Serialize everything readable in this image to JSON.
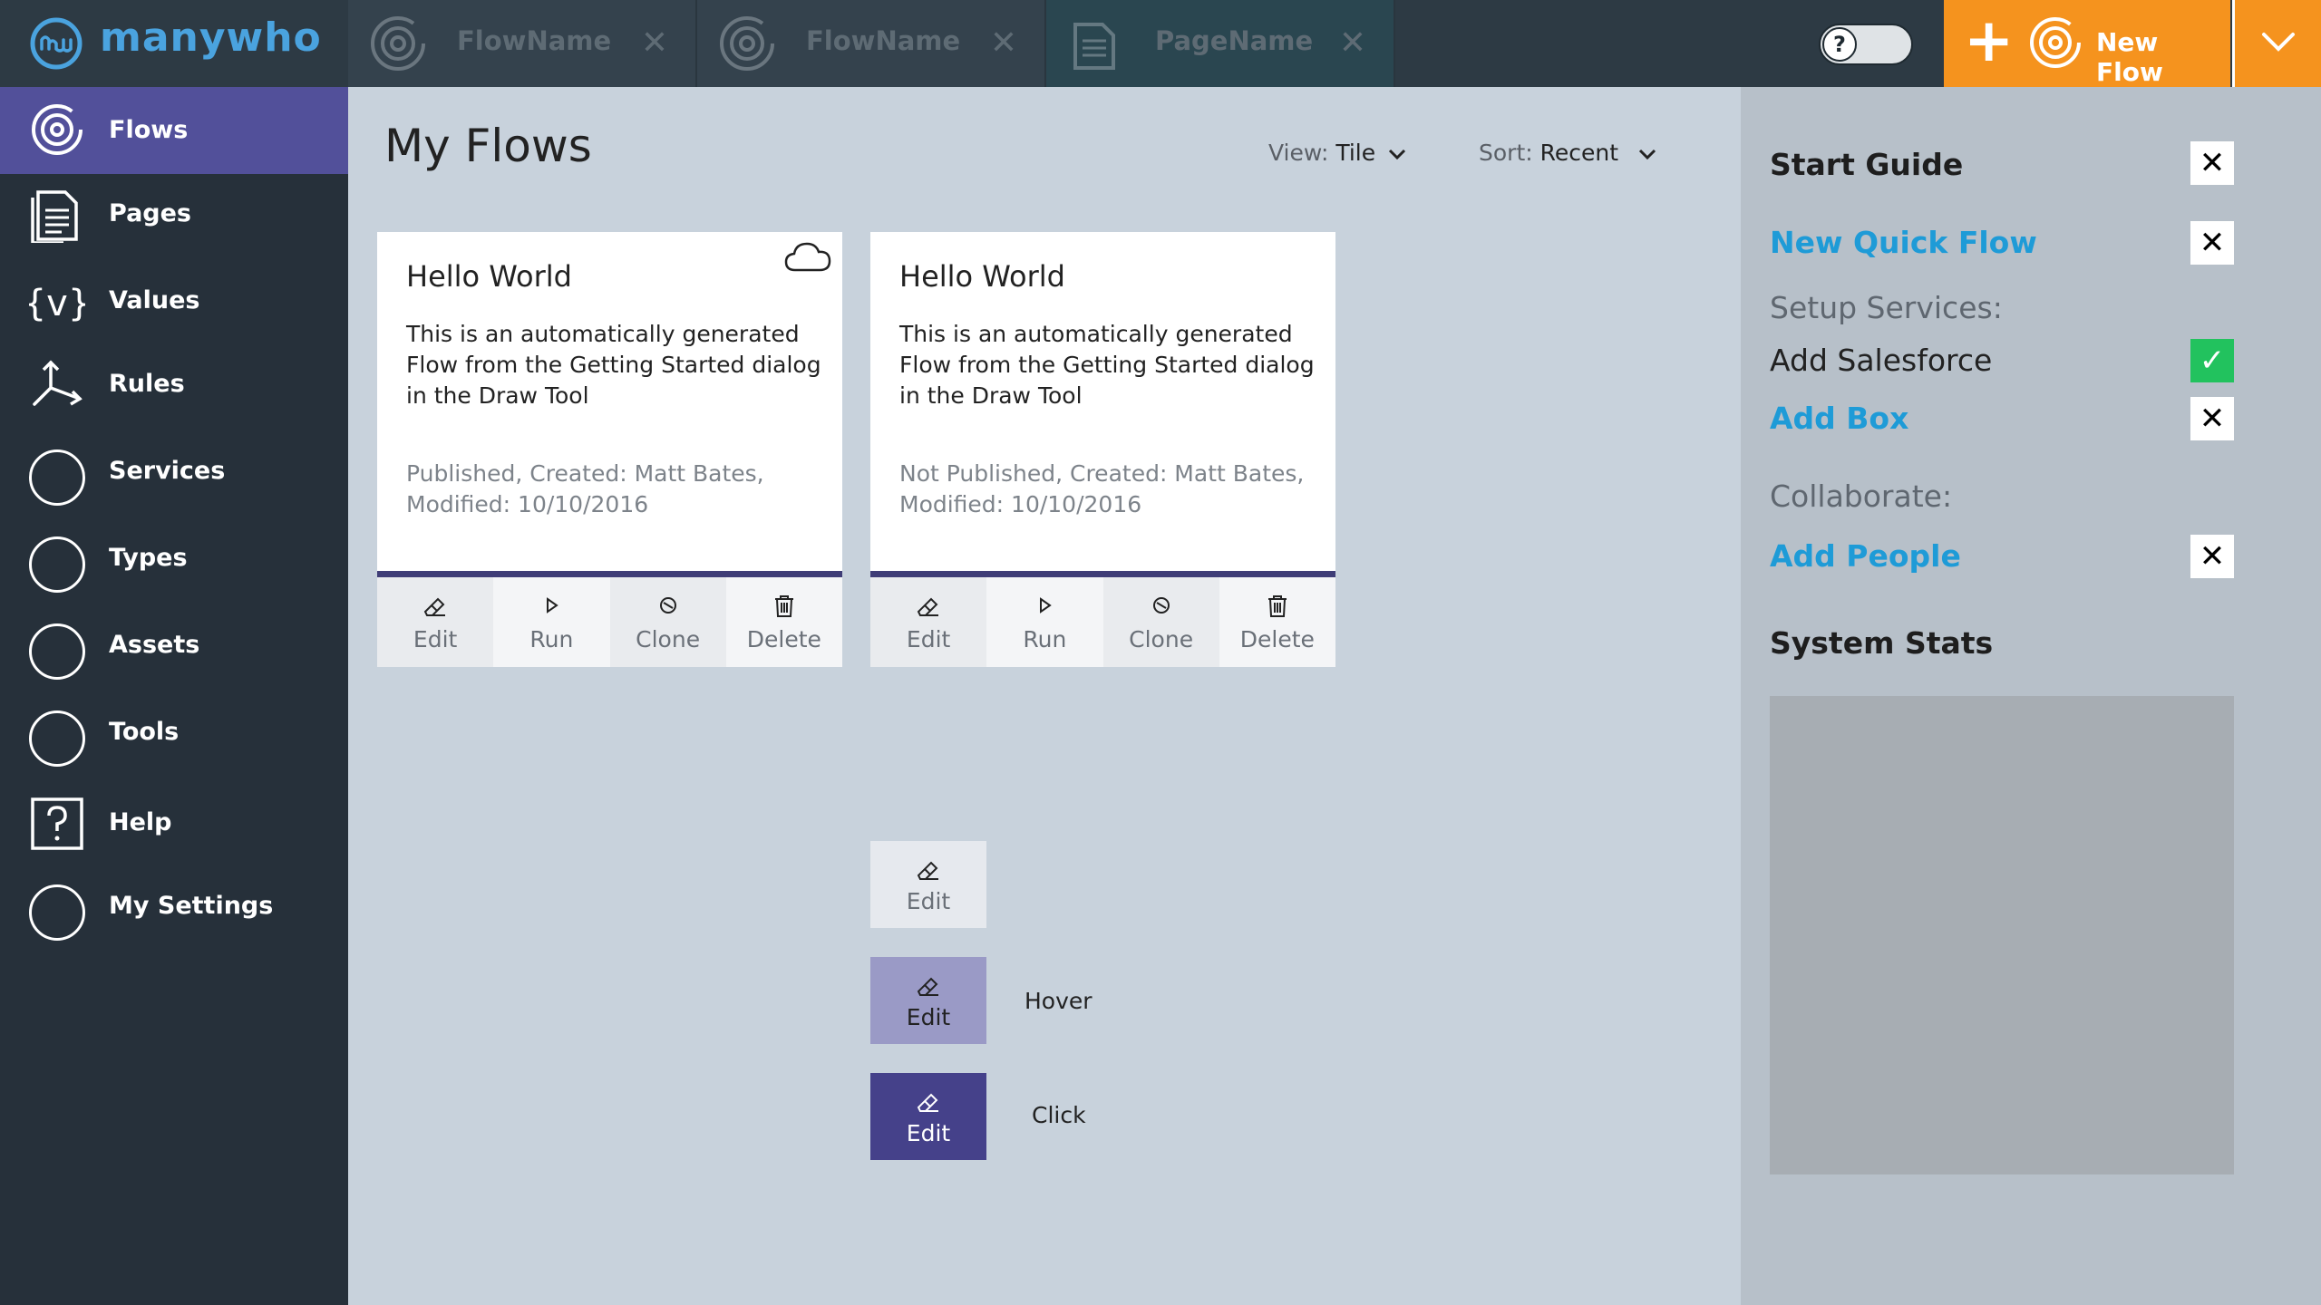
{
  "brand": {
    "logo_text": "manywho"
  },
  "tabs": [
    {
      "label": "FlowName",
      "icon": "flow-icon",
      "close": "✕"
    },
    {
      "label": "FlowName",
      "icon": "flow-icon",
      "close": "✕"
    },
    {
      "label": "PageName",
      "icon": "page-icon",
      "close": "✕"
    }
  ],
  "toggle": {
    "glyph": "?"
  },
  "new_flow": {
    "plus": "+",
    "label": "New Flow"
  },
  "sidebar": {
    "items": [
      {
        "label": "Flows",
        "icon": "flows-icon"
      },
      {
        "label": "Pages",
        "icon": "pages-icon"
      },
      {
        "label": "Values",
        "icon": "values-icon"
      },
      {
        "label": "Rules",
        "icon": "rules-icon"
      },
      {
        "label": "Services",
        "icon": "circle-icon"
      },
      {
        "label": "Types",
        "icon": "circle-icon"
      },
      {
        "label": "Assets",
        "icon": "circle-icon"
      },
      {
        "label": "Tools",
        "icon": "circle-icon"
      },
      {
        "label": "Help",
        "icon": "help-icon"
      },
      {
        "label": "My Settings",
        "icon": "circle-icon"
      }
    ]
  },
  "main": {
    "title": "My Flows",
    "view": {
      "label": "View:",
      "value": "Tile"
    },
    "sort": {
      "label": "Sort:",
      "value": "Recent"
    },
    "cards": [
      {
        "title": "Hello World",
        "description": "This is an automatically generated Flow from the Getting Started dialog in the Draw Tool",
        "meta": "Published, Created: Matt Bates, Modified: 10/10/2016",
        "cloud": true,
        "actions": [
          "Edit",
          "Run",
          "Clone",
          "Delete"
        ]
      },
      {
        "title": "Hello World",
        "description": "This is an automatically generated Flow from the Getting Started dialog in the Draw Tool",
        "meta": "Not Published, Created: Matt Bates, Modified: 10/10/2016",
        "cloud": false,
        "actions": [
          "Edit",
          "Run",
          "Clone",
          "Delete"
        ]
      }
    ],
    "button_states": [
      {
        "label": "Edit",
        "state_label": ""
      },
      {
        "label": "Edit",
        "state_label": "Hover"
      },
      {
        "label": "Edit",
        "state_label": "Click"
      }
    ]
  },
  "right_panel": {
    "start_guide": "Start Guide",
    "new_quick_flow": "New Quick Flow",
    "setup_services": "Setup Services:",
    "add_salesforce": "Add Salesforce",
    "add_box": "Add Box",
    "collaborate": "Collaborate:",
    "add_people": "Add People",
    "system_stats": "System Stats",
    "close_glyph": "✕",
    "check_glyph": "✓"
  },
  "colors": {
    "sidebar_bg": "#26303a",
    "sidebar_active": "#52509a",
    "accent_orange": "#f5931e",
    "link_blue": "#1e9bd7",
    "check_green": "#22c25e",
    "card_bar": "#3f3d77"
  }
}
